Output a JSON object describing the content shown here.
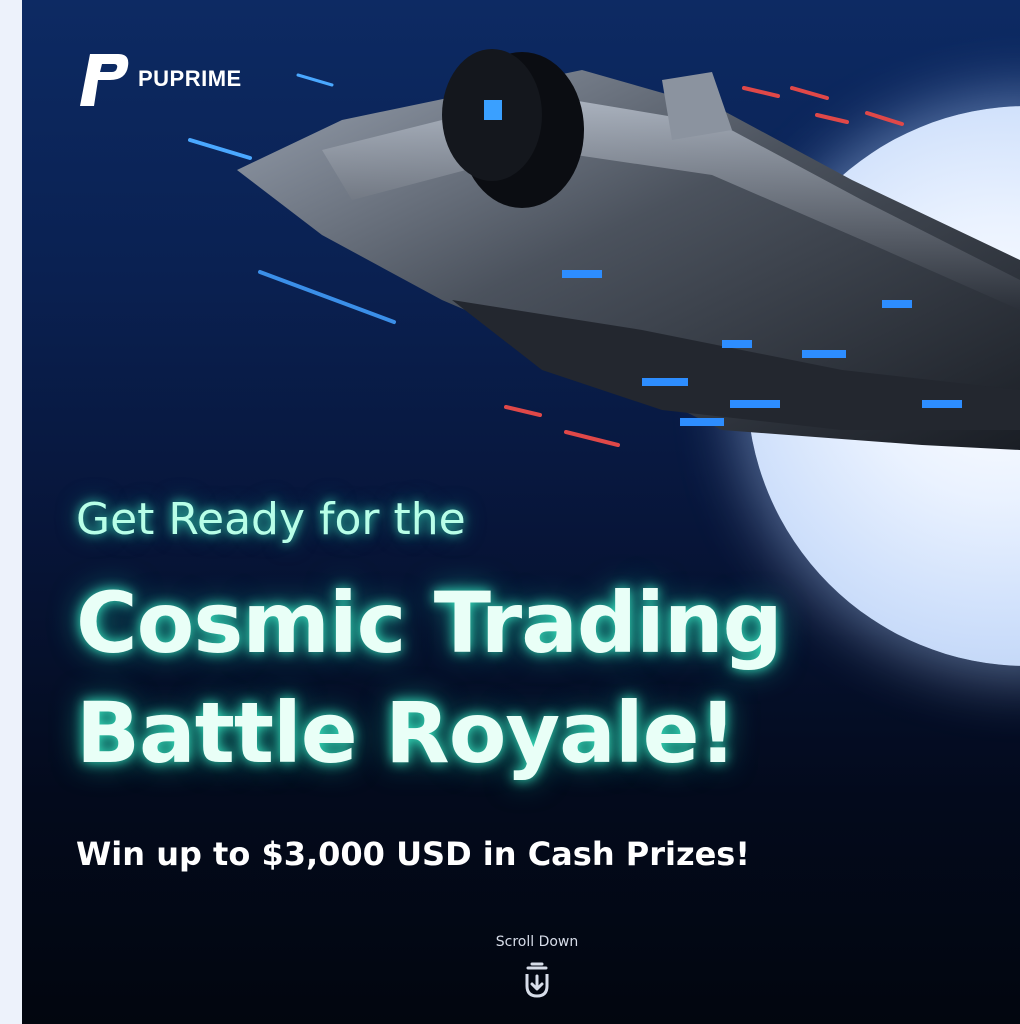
{
  "brand": {
    "name": "PUPRIME",
    "logo_icon": "puprime-p-logo-icon"
  },
  "hero": {
    "heading_line_1": "Get Ready for the",
    "heading_line_2": "Cosmic Trading",
    "heading_line_3": "Battle Royale!",
    "subheading": "Win up to $3,000 USD in Cash Prizes!"
  },
  "scroll": {
    "label": "Scroll Down",
    "icon": "scroll-down-arrow-icon"
  },
  "colors": {
    "accent_glow": "#3cf0c8",
    "heading_text": "#e9fff7",
    "background_top": "#0d2a63",
    "background_bottom": "#02060f"
  }
}
